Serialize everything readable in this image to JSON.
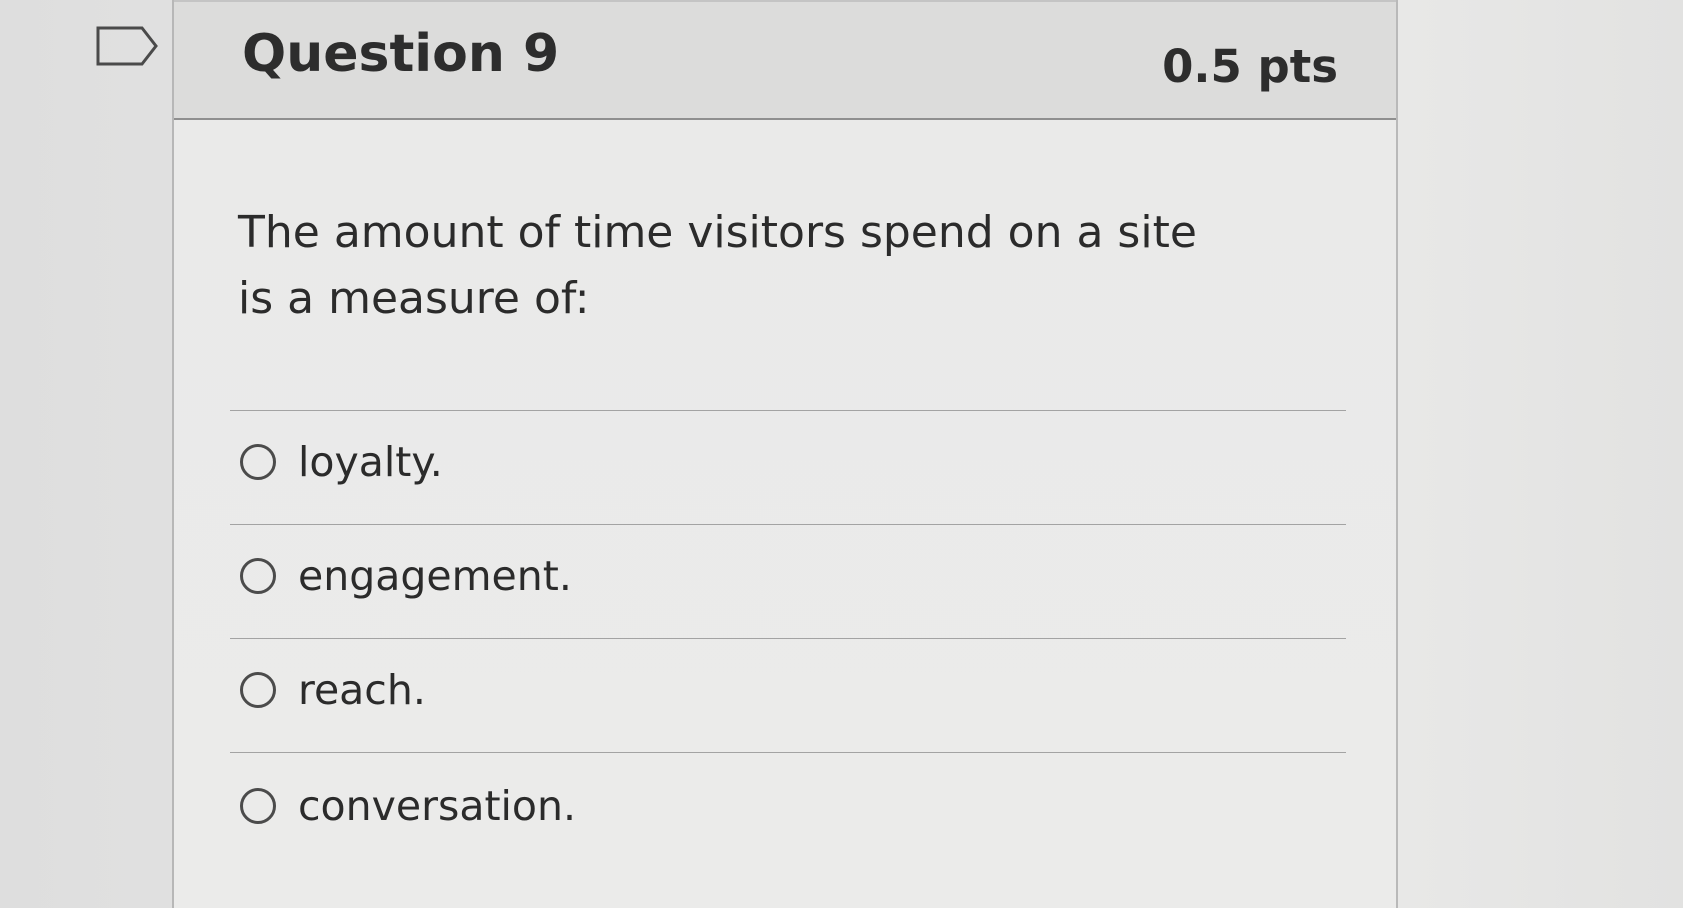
{
  "question": {
    "title": "Question 9",
    "points": "0.5 pts",
    "text": "The amount of time visitors spend on a site is a measure of:",
    "flag_icon": "flag-outline-icon"
  },
  "answers": [
    {
      "label": "loyalty.",
      "selected": false
    },
    {
      "label": "engagement.",
      "selected": false
    },
    {
      "label": "reach.",
      "selected": false
    },
    {
      "label": "conversation.",
      "selected": false
    }
  ],
  "colors": {
    "background": "#e6e6e5",
    "header": "#dcdcdb",
    "text": "#2b2b2b",
    "radio_border": "#4b4b4b"
  }
}
